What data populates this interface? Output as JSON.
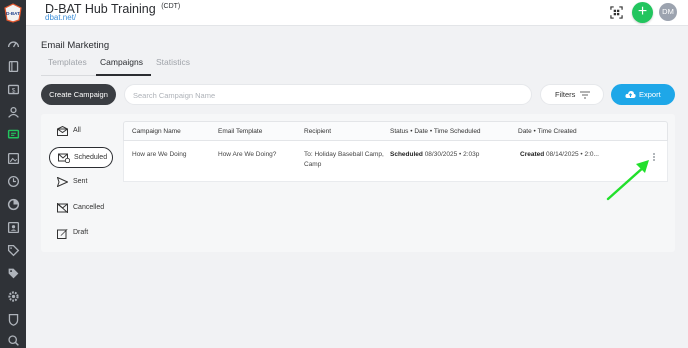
{
  "app": {
    "title": "D-BAT Hub Training",
    "timezone": "(CDT)",
    "subtitle": "dbat.net/",
    "logo_text": "D-BAT"
  },
  "header": {
    "plus_label": "+",
    "avatar_initials": "DM"
  },
  "colors": {
    "sidebar": "#2f3237",
    "active_nav": "#22c55e",
    "export": "#1ea7e8",
    "create": "#3a3d42",
    "annotation_arrow": "#22e02c"
  },
  "sidebar": {
    "items": [
      "dashboard-icon",
      "book-icon",
      "register-icon",
      "users-icon",
      "chat-icon",
      "image-icon",
      "clock-icon",
      "pie-chart-icon",
      "contacts-icon",
      "tag-icon",
      "tag-icon",
      "gear-icon",
      "shield-icon",
      "settings-search-icon"
    ],
    "active": "chat-icon"
  },
  "page": {
    "section_title": "Email Marketing",
    "tabs": [
      "Templates",
      "Campaigns",
      "Statistics"
    ],
    "active_tab": "Campaigns"
  },
  "toolbar": {
    "create_label": "Create Campaign",
    "search_placeholder": "Search Campaign Name",
    "filters_label": "Filters",
    "export_label": "Export"
  },
  "status_filters": {
    "items": [
      "All",
      "Scheduled",
      "Sent",
      "Cancelled",
      "Draft"
    ],
    "active": "Scheduled"
  },
  "table": {
    "columns": [
      "Campaign Name",
      "Email Template",
      "Recipient",
      "Status • Date • Time Scheduled",
      "Date • Time Created"
    ],
    "rows": [
      {
        "campaign_name": "How are We Doing",
        "email_template": "How Are We Doing?",
        "recipient_line1": "To: Holiday Baseball Camp,",
        "recipient_line2": "Camp",
        "status": "Scheduled",
        "scheduled": "08/30/2025 • 2:03p",
        "created_status": "Created",
        "created": "08/14/2025 • 2:0..."
      }
    ]
  }
}
